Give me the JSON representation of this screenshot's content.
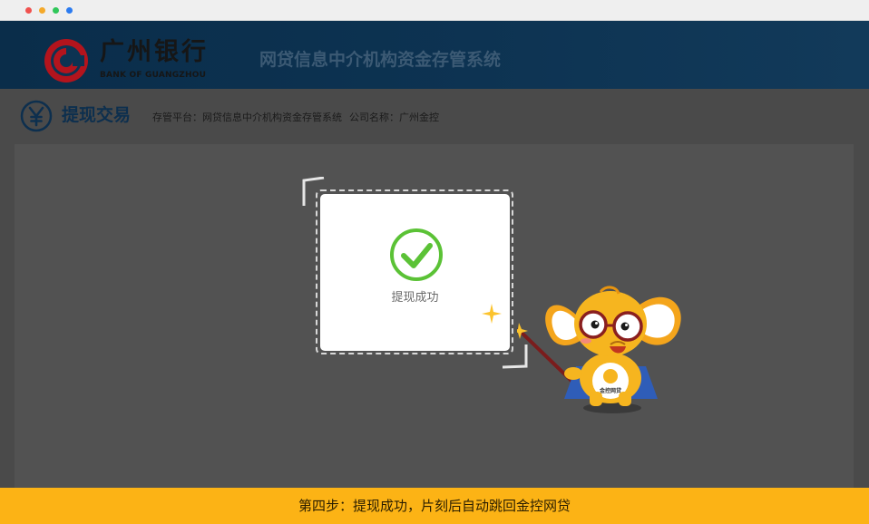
{
  "header": {
    "bank_name": "广州银行",
    "bank_name_en": "BANK OF GUANGZHOU",
    "system_title": "网贷信息中介机构资金存管系统"
  },
  "page": {
    "title": "提现交易",
    "platform_label": "存管平台：网贷信息中介机构资金存管系统",
    "company_label": "公司名称：广州金控"
  },
  "result": {
    "message": "提现成功"
  },
  "mascot": {
    "badge_text": "金控网贷"
  },
  "footer": {
    "step_text": "第四步：提现成功，片刻后自动跳回金控网贷"
  },
  "colors": {
    "header_bg": "#0d3352",
    "footer_bg": "#fcb315",
    "success": "#5bc236",
    "overlay": "#4a4a4a"
  }
}
